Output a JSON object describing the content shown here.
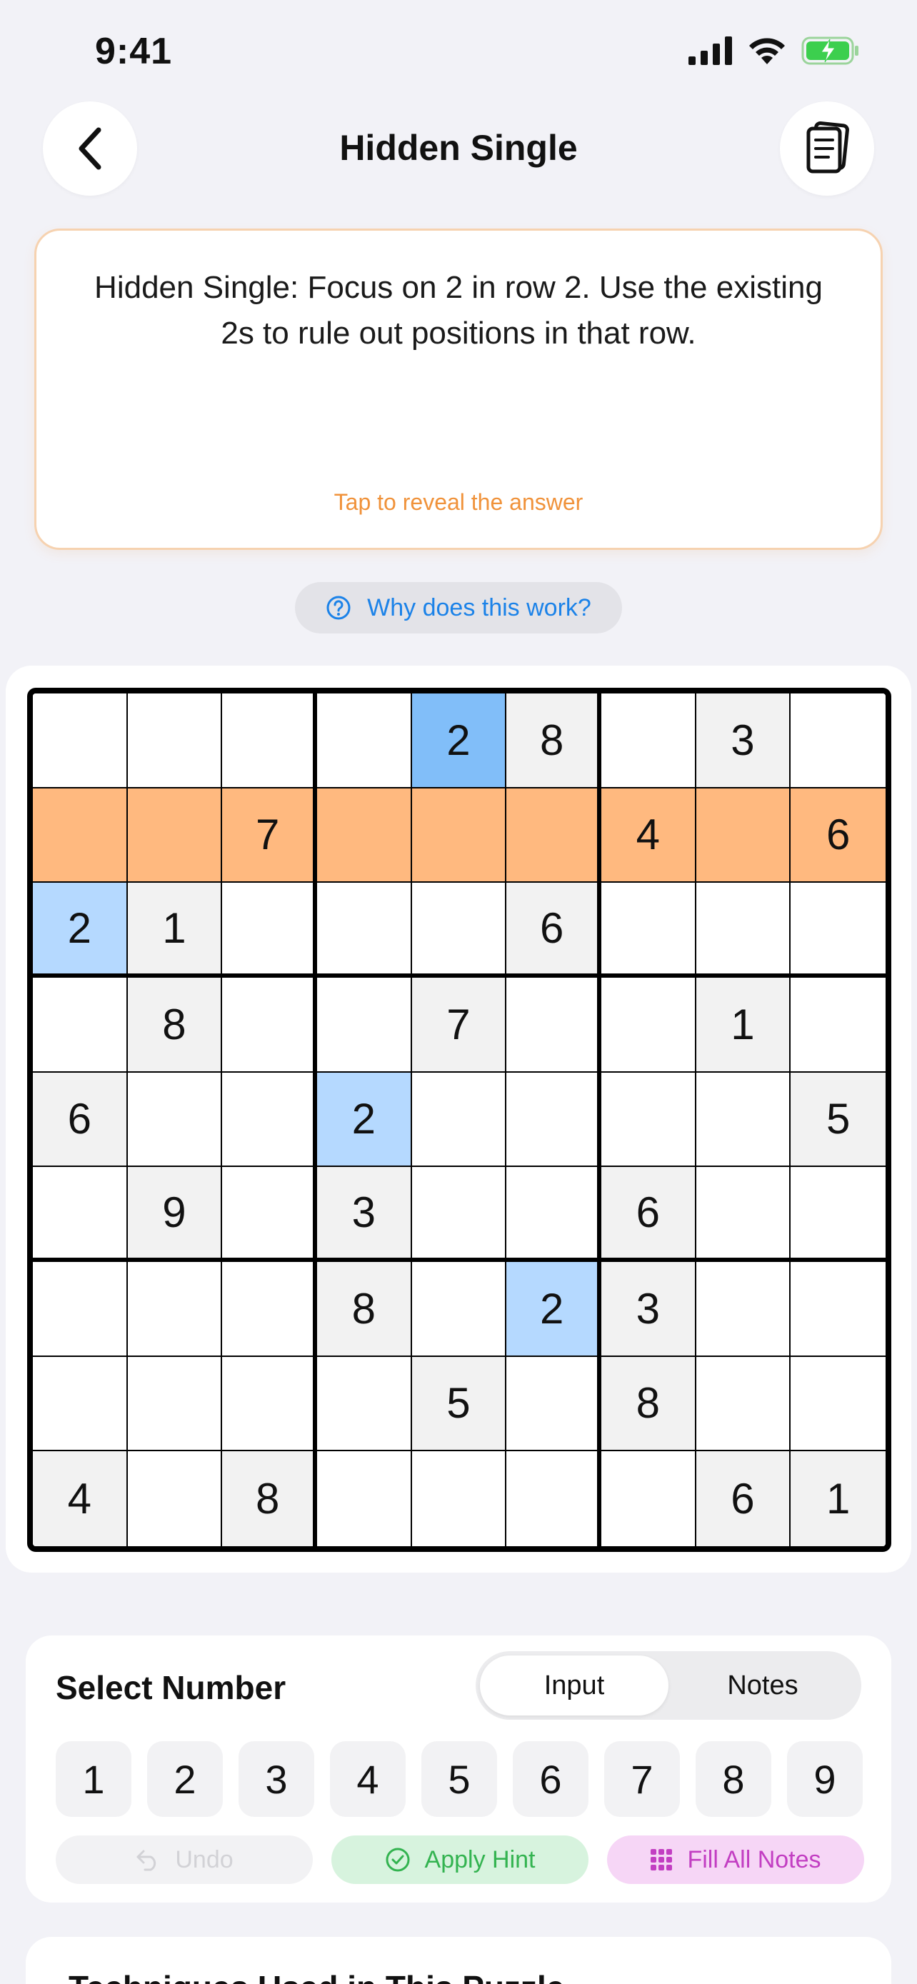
{
  "status_bar": {
    "time": "9:41"
  },
  "header": {
    "title": "Hidden Single"
  },
  "hint": {
    "text": "Hidden Single: Focus on 2 in row 2. Use the existing 2s to rule out positions in that row.",
    "reveal": "Tap to reveal the answer"
  },
  "why": {
    "label": "Why does this work?"
  },
  "board": {
    "cells": [
      [
        "",
        "",
        "",
        "",
        "2",
        "8",
        "",
        "3",
        ""
      ],
      [
        "",
        "",
        "7",
        "",
        "",
        "",
        "4",
        "",
        "6"
      ],
      [
        "2",
        "1",
        "",
        "",
        "",
        "6",
        "",
        "",
        ""
      ],
      [
        "",
        "8",
        "",
        "",
        "7",
        "",
        "",
        "1",
        ""
      ],
      [
        "6",
        "",
        "",
        "2",
        "",
        "",
        "",
        "",
        "5"
      ],
      [
        "",
        "9",
        "",
        "3",
        "",
        "",
        "6",
        "",
        ""
      ],
      [
        "",
        "",
        "",
        "8",
        "",
        "2",
        "3",
        "",
        ""
      ],
      [
        "",
        "",
        "",
        "",
        "5",
        "",
        "8",
        "",
        ""
      ],
      [
        "4",
        "",
        "8",
        "",
        "",
        "",
        "",
        "6",
        "1"
      ]
    ],
    "highlighted_row": 1,
    "highlighted_cells": [
      [
        0,
        4
      ],
      [
        2,
        0
      ],
      [
        4,
        3
      ],
      [
        6,
        5
      ]
    ],
    "strong_highlight": [
      0,
      4
    ],
    "colors": {
      "row_highlight": "#ffb97f",
      "digit_highlight": "#b5d9ff",
      "digit_highlight_strong": "#81bef9",
      "given_cell": "#f2f2f2"
    }
  },
  "number_panel": {
    "title": "Select Number",
    "modes": [
      "Input",
      "Notes"
    ],
    "active_mode": "Input",
    "numbers": [
      "1",
      "2",
      "3",
      "4",
      "5",
      "6",
      "7",
      "8",
      "9"
    ],
    "undo_label": "Undo",
    "apply_hint_label": "Apply Hint",
    "fill_notes_label": "Fill All Notes"
  },
  "techniques": {
    "title": "Techniques Used in This Puzzle"
  }
}
